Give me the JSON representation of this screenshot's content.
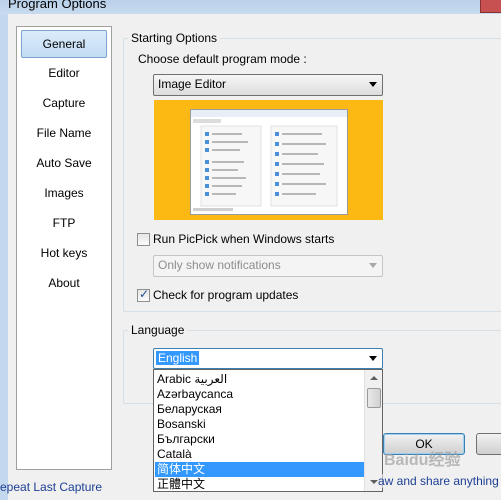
{
  "window": {
    "title": "Program Options"
  },
  "sidebar": {
    "items": [
      {
        "label": "General",
        "selected": true
      },
      {
        "label": "Editor"
      },
      {
        "label": "Capture"
      },
      {
        "label": "File Name"
      },
      {
        "label": "Auto Save"
      },
      {
        "label": "Images"
      },
      {
        "label": "FTP"
      },
      {
        "label": "Hot keys"
      },
      {
        "label": "About"
      }
    ]
  },
  "starting": {
    "group_label": "Starting Options",
    "mode_prompt": "Choose default program mode :",
    "mode_value": "Image Editor",
    "run_on_start_label": "Run PicPick when Windows starts",
    "run_on_start_checked": false,
    "notify_value": "Only show notifications",
    "check_updates_label": "Check for program updates",
    "check_updates_checked": true
  },
  "language": {
    "group_label": "Language",
    "selected": "English",
    "options": [
      "Arabic العربية",
      "Azərbaycanca",
      "Беларуская",
      "Bosanski",
      "Български",
      "Català",
      "简体中文",
      "正體中文"
    ],
    "highlighted": "简体中文"
  },
  "buttons": {
    "ok": "OK"
  },
  "footer": {
    "link": "epeat Last Capture",
    "overlay_text": "aw and share anything"
  },
  "watermark": {
    "text": "Baidu经验"
  },
  "colors": {
    "preview_bg": "#fdb913",
    "selection": "#3399ff",
    "link": "#1c3f94"
  }
}
